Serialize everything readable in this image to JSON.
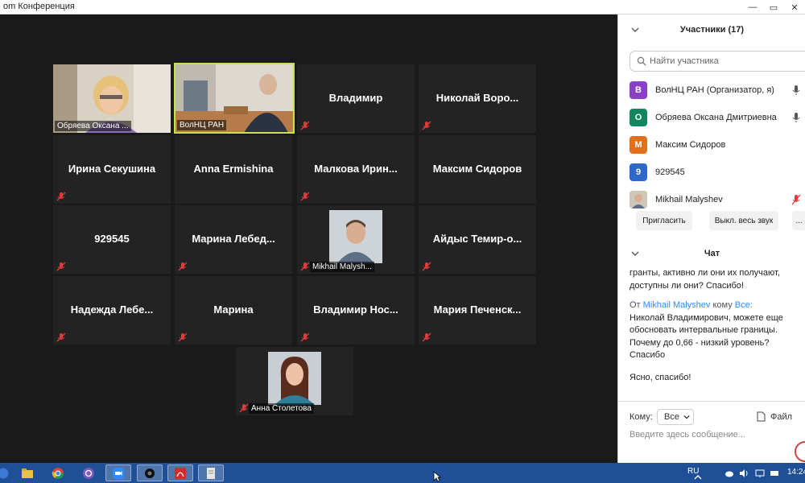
{
  "window": {
    "title": "om Конференция"
  },
  "tiles": [
    {
      "name": "Обряева Оксана ..."
    },
    {
      "name": "ВолНЦ РАН"
    },
    {
      "name": "Владимир"
    },
    {
      "name": "Николай  Воро..."
    },
    {
      "name": "Ирина Секушина"
    },
    {
      "name": "Anna Ermishina"
    },
    {
      "name": "Малкова  Ирин..."
    },
    {
      "name": "Максим Сидоров"
    },
    {
      "name": "929545"
    },
    {
      "name": "Марина  Лебед..."
    },
    {
      "name": "Mikhail Malysh..."
    },
    {
      "name": "Айдыс  Темир-о..."
    },
    {
      "name": "Надежда  Лебе..."
    },
    {
      "name": "Марина"
    },
    {
      "name": "Владимир  Нос..."
    },
    {
      "name": "Мария  Печенск..."
    },
    {
      "name": "Анна Столетова"
    }
  ],
  "participants_panel": {
    "title": "Участники (17)",
    "search_placeholder": "Найти участника",
    "participants": [
      {
        "initial": "В",
        "name": "ВолНЦ РАН (Организатор, я)",
        "color": "#8b3fc7"
      },
      {
        "initial": "О",
        "name": "Обряева Оксана Дмитриевна",
        "color": "#13865f"
      },
      {
        "initial": "М",
        "name": "Максим Сидоров",
        "color": "#e0701b"
      },
      {
        "initial": "9",
        "name": "929545",
        "color": "#2e69c9"
      },
      {
        "initial": "",
        "name": "Mikhail Malyshev",
        "color": "#b9a48c"
      }
    ],
    "invite_label": "Пригласить",
    "mute_all_label": "Выкл. весь звук",
    "more_label": "..."
  },
  "chat": {
    "title": "Чат",
    "prev_message": "гранты, активно ли они их получают, доступны ли они? Спасибо!",
    "from_label": "От",
    "sender": "Mikhail Malyshev",
    "to_word": "кому",
    "recipient": "Все:",
    "message": "Николай Владимирович, можете еще обосновать интервальные границы. Почему до 0,66 - низкий уровень? Спасибо",
    "message2": "Ясно, спасибо!",
    "to_label": "Кому:",
    "to_value": "Все",
    "file_label": "Файл",
    "input_placeholder": "Введите здесь сообщение..."
  },
  "taskbar": {
    "lang": "RU",
    "time": "14:24"
  }
}
